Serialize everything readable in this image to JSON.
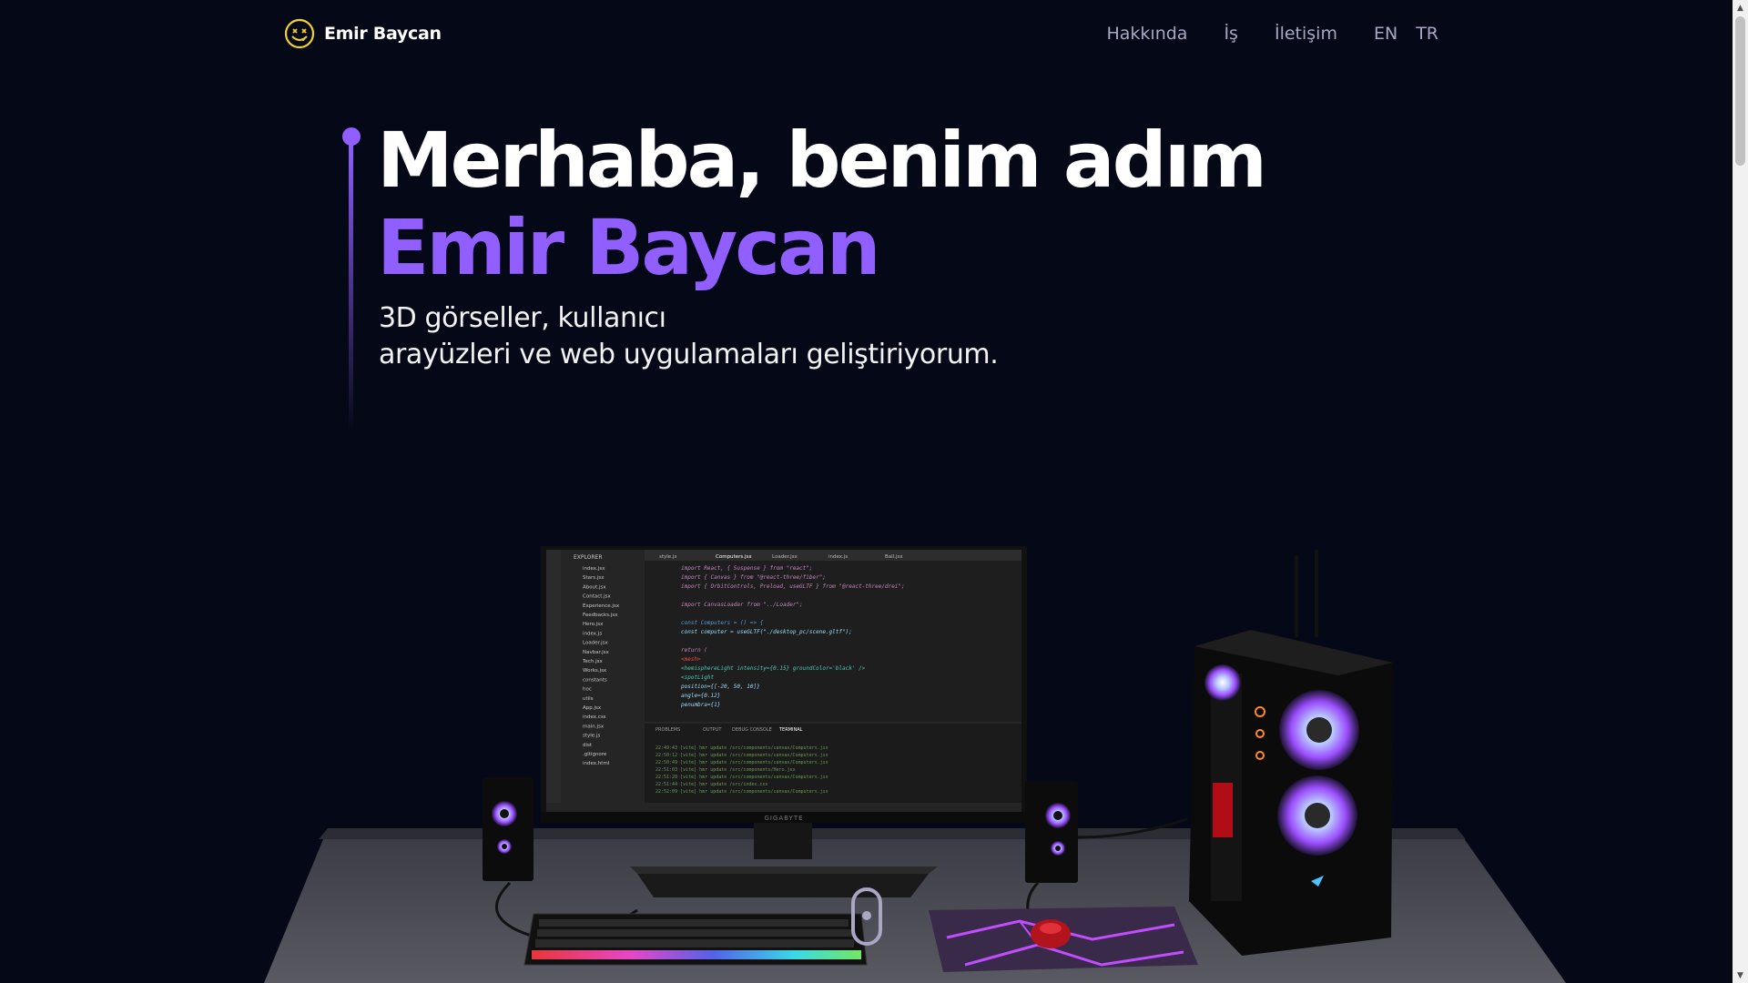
{
  "nav": {
    "logo_text": "Emir Baycan",
    "links": [
      "Hakkında",
      "İş",
      "İletişim"
    ],
    "langs": [
      "EN",
      "TR"
    ]
  },
  "hero": {
    "title_line1": "Merhaba, benim adım",
    "title_name": "Emir Baycan",
    "subtitle_line1": "3D görseller, kullanıcı",
    "subtitle_line2": "arayüzleri ve web uygulamaları geliştiriyorum."
  },
  "scene": {
    "monitor_brand": "GIGABYTE",
    "editor_tabs": [
      "style.js",
      "Computers.jsx",
      "Loader.jsx",
      "index.js",
      "Ball.jsx"
    ],
    "explorer_title": "EXPLORER",
    "panel_tabs": [
      "PROBLEMS",
      "OUTPUT",
      "DEBUG CONSOLE",
      "TERMINAL"
    ],
    "code_lines": [
      "import React, { Suspense } from \"react\";",
      "import { Canvas } from \"@react-three/fiber\";",
      "import { OrbitControls, Preload, useGLTF } from \"@react-three/drei\";",
      "",
      "import CanvasLoader from \"../Loader\";",
      "",
      "const Computers = () => {",
      "  const computer = useGLTF(\"./desktop_pc/scene.gltf\");",
      "",
      "  return (",
      "    <mesh>",
      "      <hemisphereLight intensity={0.15} groundColor='black' />",
      "      <spotLight",
      "        position={[-20, 50, 10]}",
      "        angle={0.12}",
      "        penumbra={1}"
    ],
    "explorer_files": [
      "index.jsx",
      "Stars.jsx",
      "About.jsx",
      "Contact.jsx",
      "Experience.jsx",
      "Feedbacks.jsx",
      "Hero.jsx",
      "index.js",
      "Loader.jsx",
      "Navbar.jsx",
      "Tech.jsx",
      "Works.jsx",
      "constants",
      "hoc",
      "utils",
      "App.jsx",
      "index.css",
      "main.jsx",
      "style.js",
      "dist",
      ".gitignore",
      "index.html"
    ]
  },
  "colors": {
    "accent": "#915eff",
    "bg": "#050816",
    "secondary": "#aaa6c3"
  }
}
